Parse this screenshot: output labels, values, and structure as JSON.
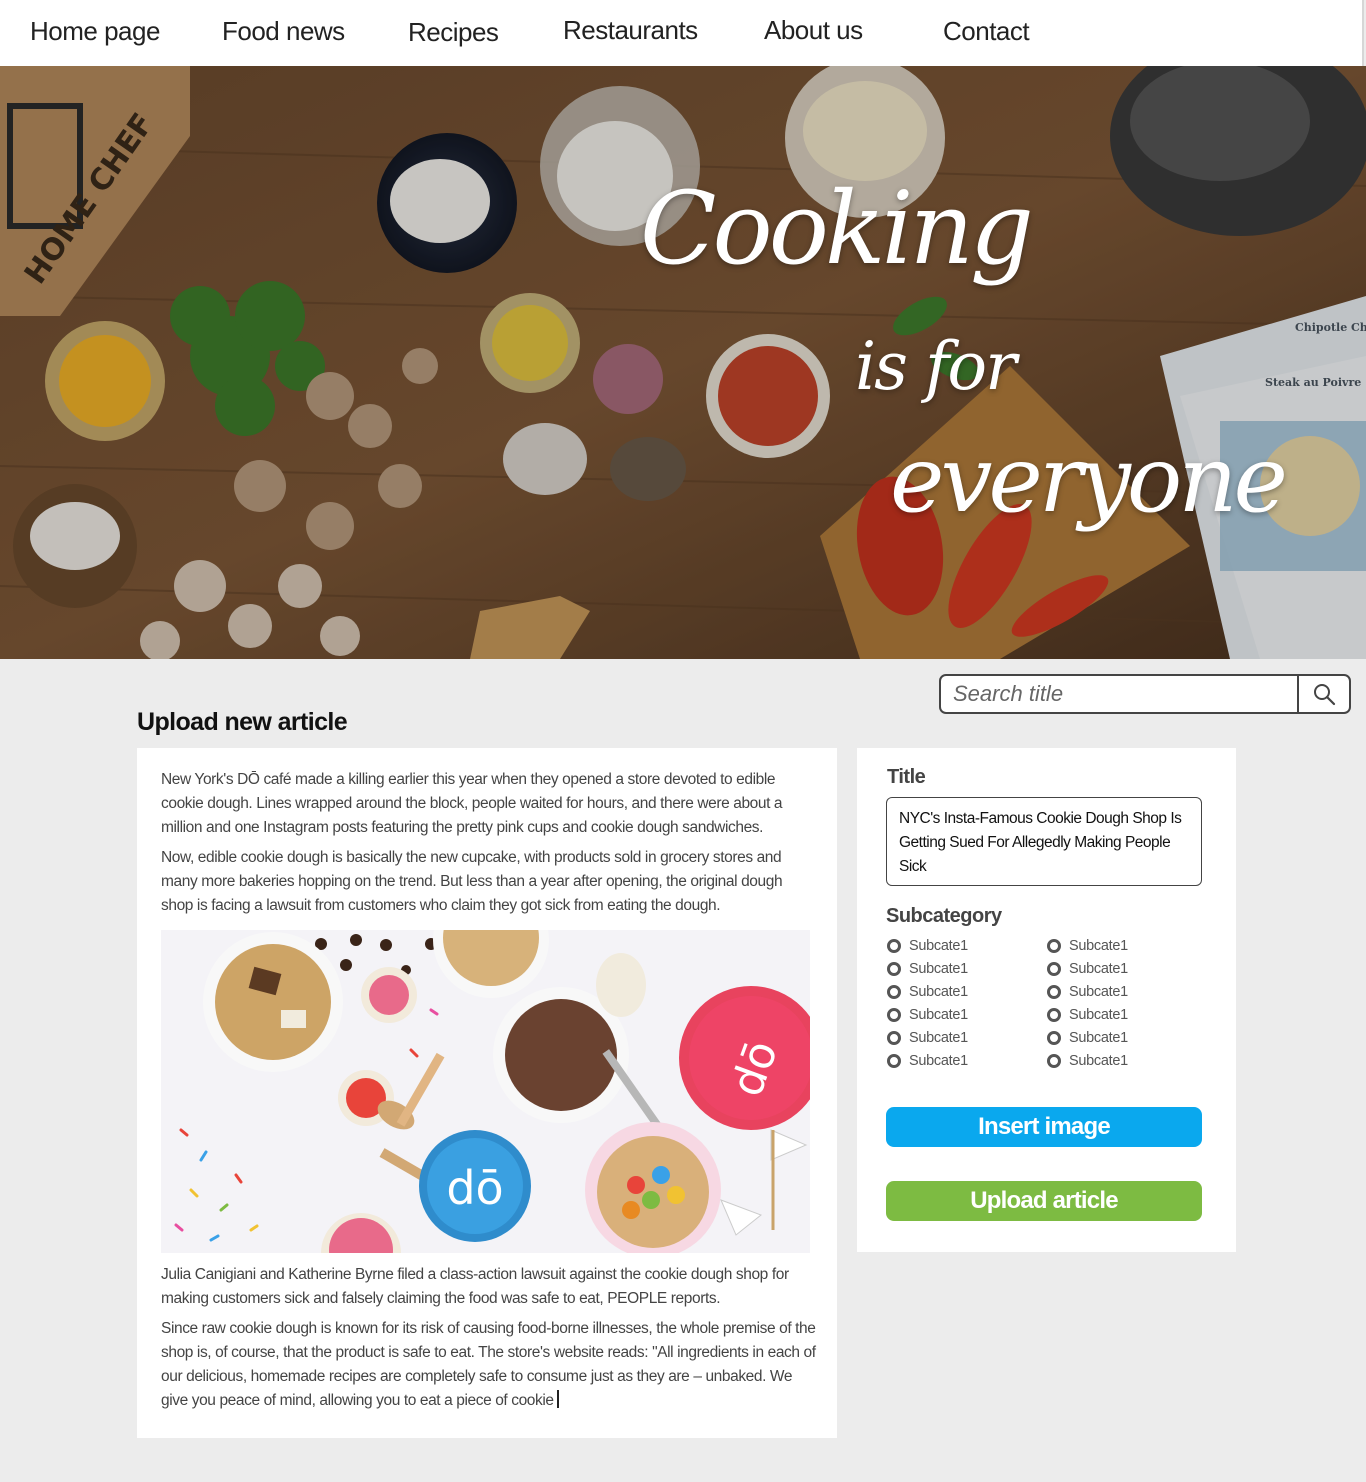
{
  "nav": {
    "items": [
      {
        "label": "Home page"
      },
      {
        "label": "Food news"
      },
      {
        "label": "Recipes"
      },
      {
        "label": "Restaurants"
      },
      {
        "label": "About us"
      },
      {
        "label": "Contact"
      }
    ]
  },
  "hero": {
    "line1": "Cooking",
    "line2": "is for",
    "line3": "everyone",
    "box_text": "HOME CHEF",
    "card1_title": "Chipotle Chic Cheddar Butt",
    "card2_title": "Steak au Poivre"
  },
  "search": {
    "placeholder": "Search title",
    "icon": "magnifier-icon"
  },
  "page": {
    "section_title": "Upload new article"
  },
  "article": {
    "paragraphs": [
      "New York's DŌ café made a killing earlier this year when they opened a store devoted to edible cookie dough. Lines wrapped around the block, people waited for hours, and there were about a million and one Instagram posts featuring the pretty pink cups and cookie dough sandwiches.",
      "Now, edible cookie dough is basically the new cupcake, with products sold in grocery stores and many more bakeries hopping on the trend. But less than a year after opening, the original dough shop is facing a lawsuit from customers who claim they got sick from eating the dough.",
      "Julia Canigiani and Katherine Byrne filed a class-action lawsuit against the cookie dough shop for making customers sick and falsely claiming the food was safe to eat, PEOPLE reports.",
      "Since raw cookie dough is known for its risk of causing food-borne illnesses, the whole premise of the shop is, of course, that the product is safe to eat. The store's website reads: \"All ingredients in each of our delicious, homemade recipes are completely safe to consume just as they are – unbaked. We give you peace of mind, allowing you to eat a piece of cookie"
    ],
    "image_logo": "dō"
  },
  "form": {
    "title_label": "Title",
    "title_value": "NYC's Insta-Famous Cookie Dough Shop Is Getting Sued For Allegedly Making People Sick",
    "subcategory_label": "Subcategory",
    "subcategories_left": [
      "Subcate1",
      "Subcate1",
      "Subcate1",
      "Subcate1",
      "Subcate1",
      "Subcate1"
    ],
    "subcategories_right": [
      "Subcate1",
      "Subcate1",
      "Subcate1",
      "Subcate1",
      "Subcate1",
      "Subcate1"
    ],
    "insert_image_label": "Insert image",
    "upload_label": "Upload article"
  },
  "colors": {
    "insert_button": "#0aa8ee",
    "upload_button": "#7dbb42",
    "page_background": "#ececec"
  }
}
